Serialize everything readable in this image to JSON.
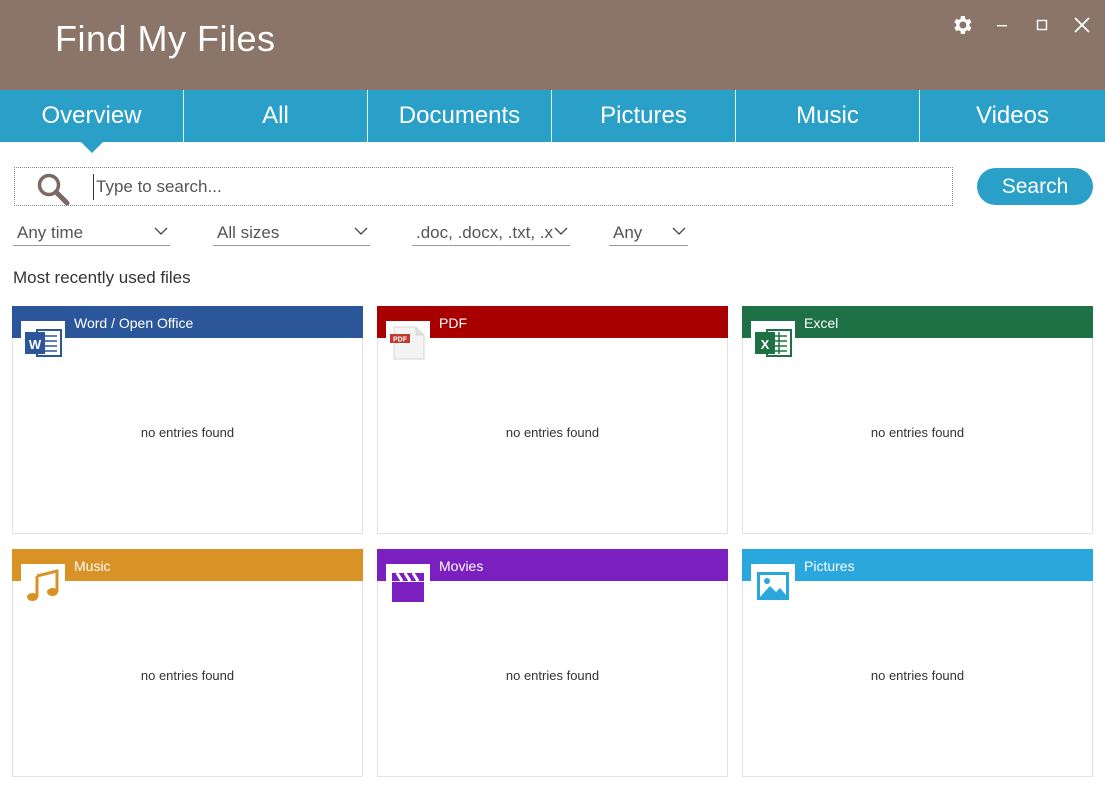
{
  "app": {
    "title": "Find My Files"
  },
  "tabs": [
    {
      "label": "Overview",
      "active": true
    },
    {
      "label": "All"
    },
    {
      "label": "Documents"
    },
    {
      "label": "Pictures"
    },
    {
      "label": "Music"
    },
    {
      "label": "Videos"
    }
  ],
  "search": {
    "placeholder": "Type to search...",
    "value": "",
    "button_label": "Search"
  },
  "filters": {
    "time": "Any time",
    "size": "All sizes",
    "types": ".doc, .docx, .txt, .xl",
    "other": "Any"
  },
  "section_title": "Most recently used files",
  "cards": [
    {
      "label": "Word / Open Office",
      "color": "#2b579a",
      "icon": "word-icon",
      "empty_text": "no entries found"
    },
    {
      "label": "PDF",
      "color": "#a80000",
      "icon": "pdf-icon",
      "empty_text": "no entries found"
    },
    {
      "label": "Excel",
      "color": "#1e7145",
      "icon": "excel-icon",
      "empty_text": "no entries found"
    },
    {
      "label": "Music",
      "color": "#d99226",
      "icon": "music-note-icon",
      "empty_text": "no entries found"
    },
    {
      "label": "Movies",
      "color": "#7b1fc0",
      "icon": "clapperboard-icon",
      "empty_text": "no entries found"
    },
    {
      "label": "Pictures",
      "color": "#2aa7dd",
      "icon": "picture-icon",
      "empty_text": "no entries found"
    }
  ],
  "colors": {
    "titlebar": "#8b7468",
    "accent": "#2aa0c9"
  }
}
